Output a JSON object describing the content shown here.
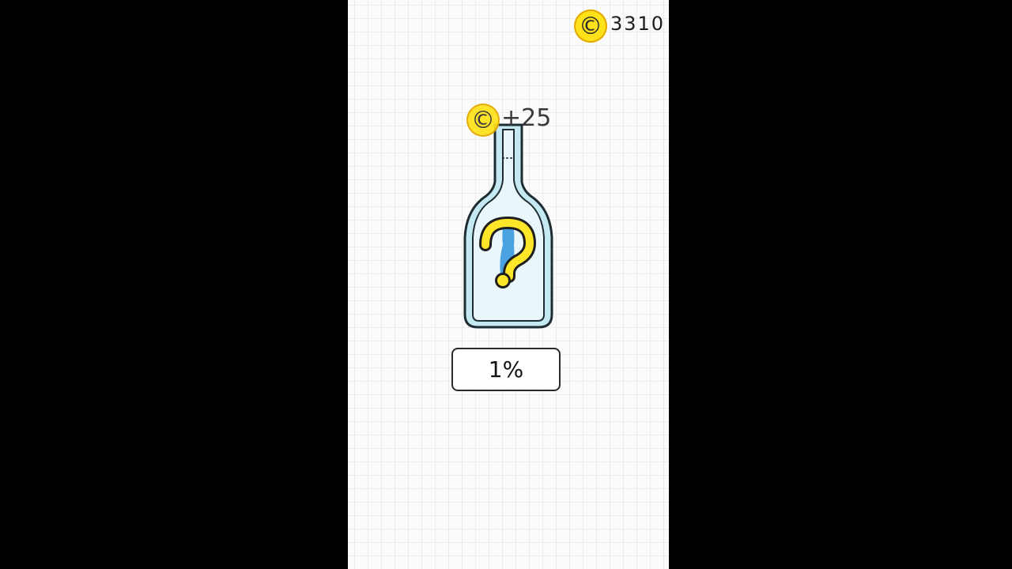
{
  "hud": {
    "coin_icon": "coin-icon",
    "coin_total": "3310"
  },
  "reward": {
    "coin_icon": "coin-icon",
    "amount": "+25"
  },
  "bottle": {
    "icon": "question-mark-icon",
    "liquid_color": "#4aa3e0",
    "glass_color": "#c5e9f3"
  },
  "progress": {
    "label": "1%",
    "value": 0.01
  },
  "colors": {
    "coin": "#ffe21a",
    "question_mark": "#ffe629",
    "background": "#fbfbfb"
  }
}
